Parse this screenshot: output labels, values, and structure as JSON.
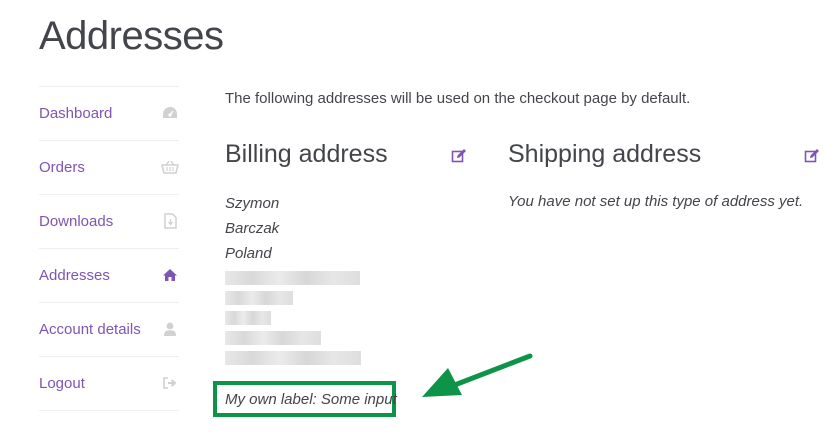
{
  "page": {
    "title": "Addresses"
  },
  "nav": {
    "items": [
      {
        "label": "Dashboard",
        "icon": "dashboard-icon"
      },
      {
        "label": "Orders",
        "icon": "basket-icon"
      },
      {
        "label": "Downloads",
        "icon": "file-download-icon"
      },
      {
        "label": "Addresses",
        "icon": "home-icon",
        "active": true
      },
      {
        "label": "Account details",
        "icon": "user-icon"
      },
      {
        "label": "Logout",
        "icon": "sign-out-icon"
      }
    ]
  },
  "intro": "The following addresses will be used on the checkout page by default.",
  "billing": {
    "title": "Billing address",
    "lines": [
      "Szymon",
      "Barczak",
      "Poland"
    ],
    "custom_field": "My own label: Some input"
  },
  "shipping": {
    "title": "Shipping address",
    "empty_message": "You have not set up this type of address yet."
  },
  "colors": {
    "accent": "#7f54b3",
    "text": "#43454b",
    "icon_muted": "#d1d1d1",
    "highlight_green": "#0e9449"
  }
}
